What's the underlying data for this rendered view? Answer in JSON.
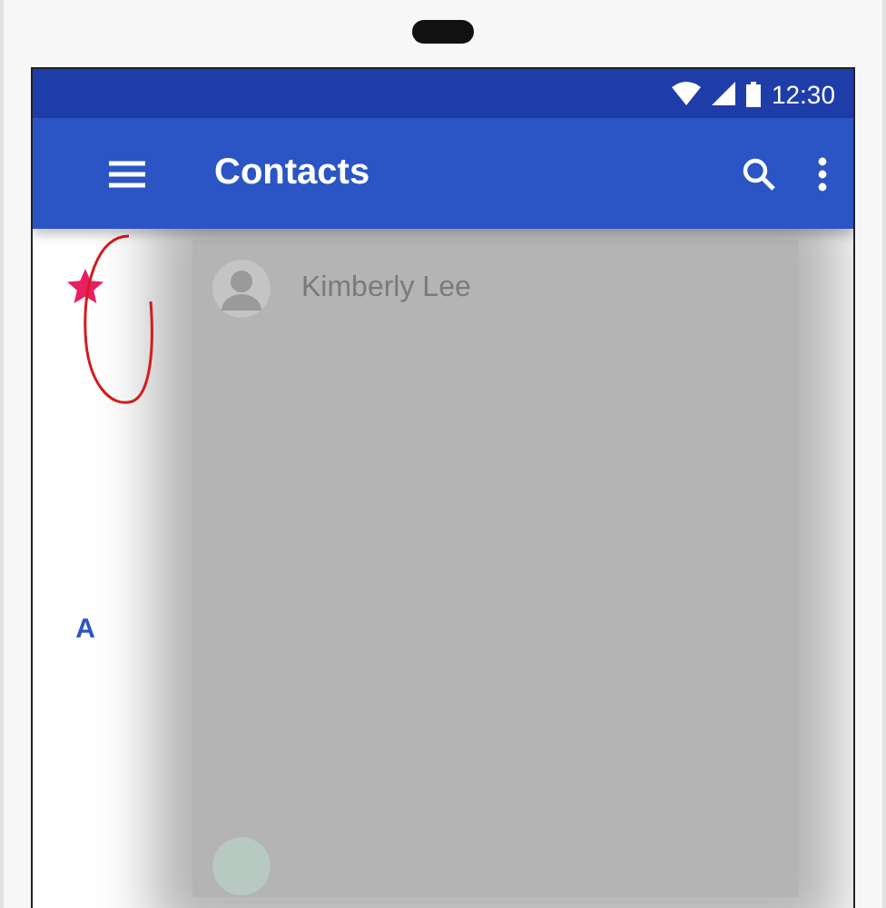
{
  "status_bar": {
    "time": "12:30"
  },
  "toolbar": {
    "title": "Contacts"
  },
  "sections": [
    {
      "kind": "starred",
      "color": "#e91e63",
      "contacts": [
        {
          "name": "Kimberly Lee"
        }
      ]
    },
    {
      "kind": "letter",
      "label": "A"
    }
  ]
}
